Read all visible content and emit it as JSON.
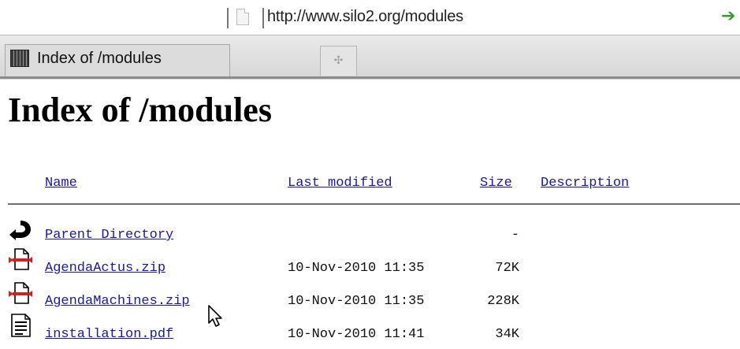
{
  "browser": {
    "url": "http://www.silo2.org/modules",
    "go_icon": "go-arrow-icon",
    "tab_title": "Index of /modules",
    "new_tab_icon": "new-tab-icon",
    "new_tab_glyph": "✣"
  },
  "page": {
    "title": "Index of /modules",
    "columns": {
      "name": "Name",
      "last_modified": "Last modified",
      "size": "Size",
      "description": "Description"
    },
    "rows": [
      {
        "icon": "back-arrow-icon",
        "name": "Parent Directory",
        "modified": "",
        "size": "-",
        "description": ""
      },
      {
        "icon": "zip-file-icon",
        "name": "AgendaActus.zip",
        "modified": "10-Nov-2010 11:35",
        "size": "72K",
        "description": ""
      },
      {
        "icon": "zip-file-icon",
        "name": "AgendaMachines.zip",
        "modified": "10-Nov-2010 11:35",
        "size": "228K",
        "description": ""
      },
      {
        "icon": "document-icon",
        "name": "installation.pdf",
        "modified": "10-Nov-2010 11:41",
        "size": "34K",
        "description": ""
      }
    ]
  },
  "colors": {
    "link": "#1a1a9a",
    "go_arrow": "#3a9a2c",
    "zip_icon_red": "#d42020"
  }
}
